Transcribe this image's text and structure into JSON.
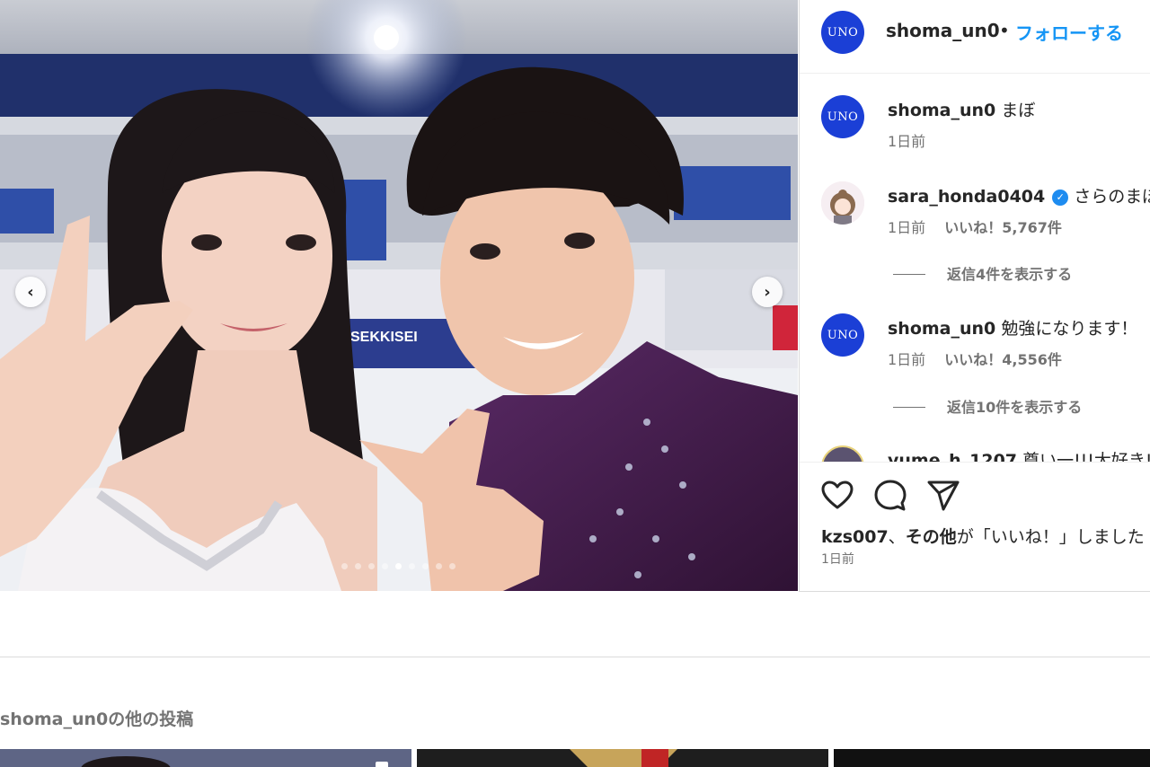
{
  "post": {
    "username": "shoma_un0",
    "avatar_text": "UNO",
    "follow_label": "フォローする",
    "separator": "•",
    "carousel": {
      "slide_count": 9,
      "active_index": 4
    }
  },
  "comments": [
    {
      "username": "shoma_un0",
      "text": "まぼ",
      "time": "1日前"
    },
    {
      "username": "sara_honda0404",
      "verified": true,
      "text": "さらのまぼ",
      "time": "1日前",
      "likes": "いいね！5,767件",
      "replies": "返信4件を表示する"
    },
    {
      "username": "shoma_un0",
      "text": "勉強になります！",
      "time": "1日前",
      "likes": "いいね！4,556件",
      "replies": "返信10件を表示する"
    },
    {
      "username": "yume_h_1207",
      "text": "尊い一!!!大好き!!"
    }
  ],
  "actions": {
    "like": "heart-icon",
    "comment": "comment-icon",
    "share": "share-icon"
  },
  "likes_summary": {
    "user": "kzs007",
    "sep": "、",
    "others": "その他",
    "suffix": "が「いいね！」しました"
  },
  "post_time": "1日前",
  "more_posts": {
    "title": "shoma_un0の他の投稿"
  },
  "colors": {
    "follow": "#1595f5",
    "avatar": "#1b3fd6",
    "verified": "#1e8cf0"
  }
}
